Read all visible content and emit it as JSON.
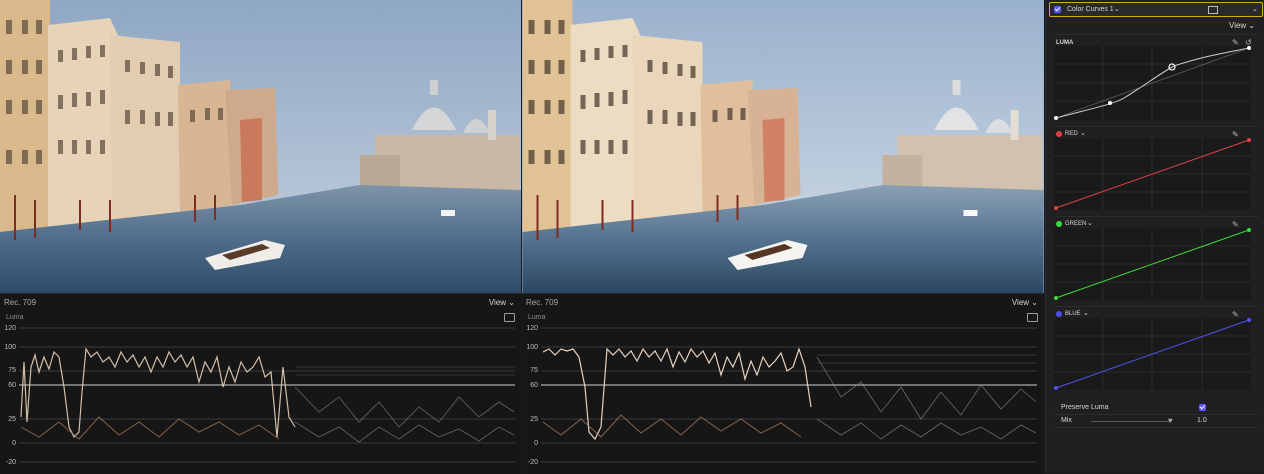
{
  "inspector": {
    "effect_name": "Color Curves 1",
    "view_label": "View",
    "channels": [
      {
        "label": "LUMA",
        "color": "#ffffff"
      },
      {
        "label": "RED",
        "color": "#e04040"
      },
      {
        "label": "GREEN",
        "color": "#3ddc3d"
      },
      {
        "label": "BLUE",
        "color": "#4e4ee8"
      }
    ],
    "preserve_luma_label": "Preserve Luma",
    "preserve_luma_checked": true,
    "mix_label": "Mix",
    "mix_value": "1.0"
  },
  "scopes": [
    {
      "colorspace": "Rec. 709",
      "view_label": "View",
      "type_label": "Luma",
      "y_ticks": [
        "120",
        "100",
        "75",
        "60",
        "25",
        "0",
        "-20"
      ]
    },
    {
      "colorspace": "Rec. 709",
      "view_label": "View",
      "type_label": "Luma",
      "y_ticks": [
        "120",
        "100",
        "75",
        "60",
        "25",
        "0",
        "-20"
      ]
    }
  ],
  "colors": {
    "accent_outline": "#d9a91a",
    "checkbox": "#5b5bff"
  }
}
